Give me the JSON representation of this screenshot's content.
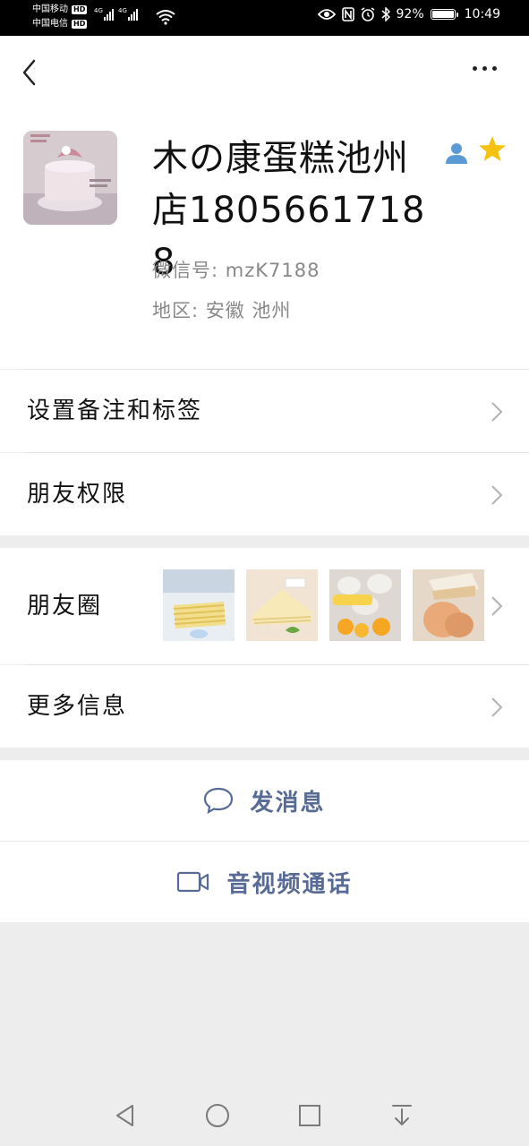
{
  "status_bar": {
    "carrier1": "中国移动",
    "carrier2": "中国电信",
    "hd": "HD",
    "net": "4G",
    "battery_text": "92%",
    "battery_level": 0.92,
    "time": "10:49"
  },
  "profile": {
    "name": "木の康蛋糕池州店18056617188",
    "wechat_id": "微信号: mzK7188",
    "region": "地区: 安徽 池州"
  },
  "menu": {
    "remark_label": "设置备注和标签",
    "permissions_label": "朋友权限",
    "moments_label": "朋友圈",
    "more_info_label": "更多信息"
  },
  "actions": {
    "message_label": "发消息",
    "call_label": "音视频通话"
  },
  "colors": {
    "accent": "#576b95",
    "star": "#f6c20f",
    "person_icon": "#5b9bd5"
  }
}
